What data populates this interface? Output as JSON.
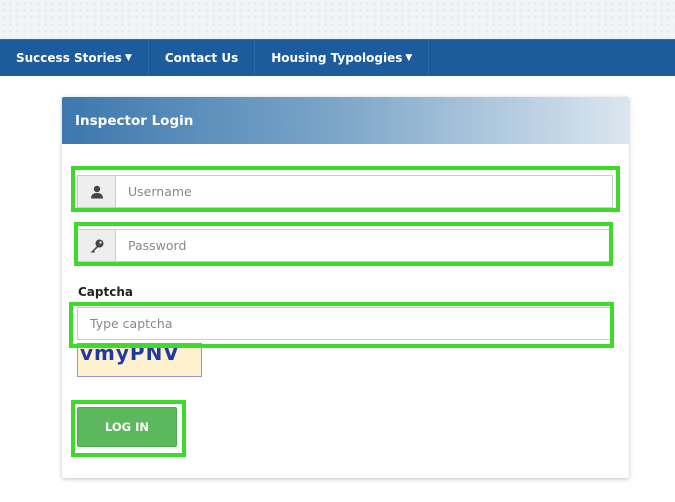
{
  "nav": {
    "items": [
      {
        "label": "Success Stories",
        "has_caret": true
      },
      {
        "label": "Contact Us",
        "has_caret": false
      },
      {
        "label": "Housing Typologies",
        "has_caret": true
      }
    ],
    "bg_color": "#1d5c9c"
  },
  "panel": {
    "title": "Inspector Login"
  },
  "form": {
    "username": {
      "placeholder": "Username",
      "icon": "user-icon"
    },
    "password": {
      "placeholder": "Password",
      "icon": "key-icon"
    },
    "captcha": {
      "label": "Captcha",
      "placeholder": "Type captcha",
      "image_text": "vmyPNV"
    },
    "login_label": "LOG IN"
  },
  "colors": {
    "login_button": "#5cb85c",
    "highlight": "#3ed92a"
  }
}
